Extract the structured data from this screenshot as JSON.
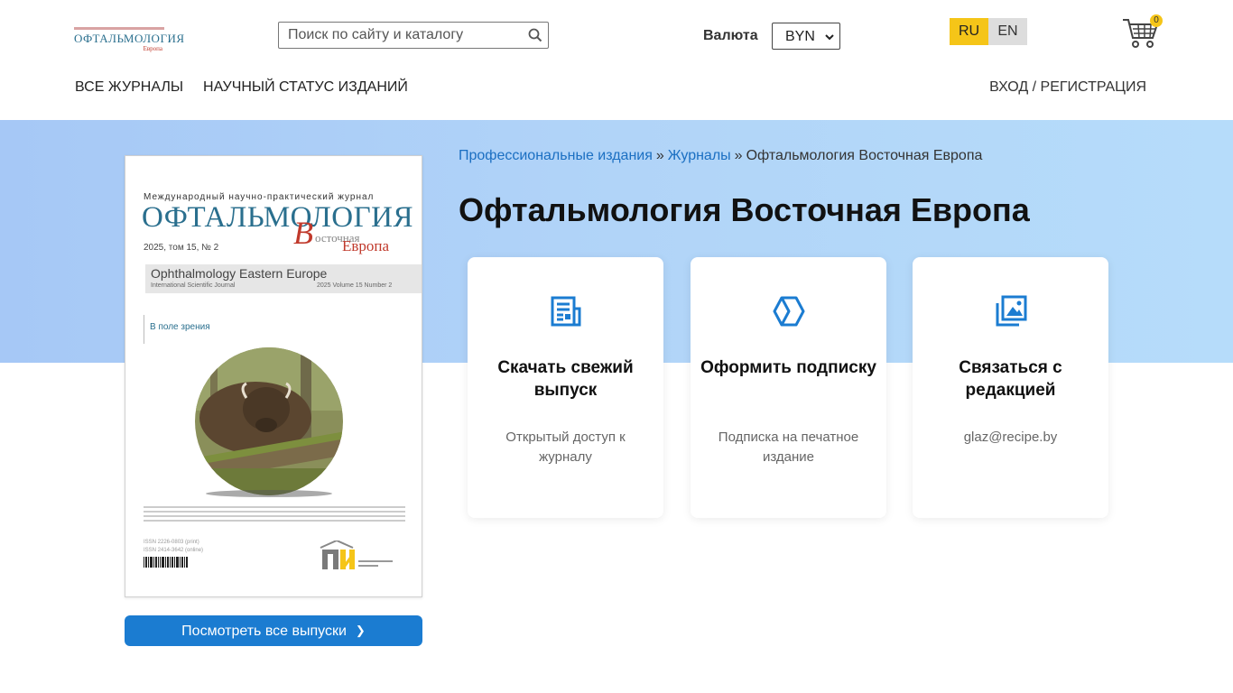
{
  "header": {
    "logo_text": "ОФТАЛЬМОЛОГИЯ",
    "logo_sub": "Европа",
    "search_placeholder": "Поиск по сайту и каталогу",
    "currency_label": "Валюта",
    "currency_value": "BYN",
    "lang_ru": "RU",
    "lang_en": "EN",
    "cart_count": "0"
  },
  "nav": {
    "all_journals": "ВСЕ ЖУРНАЛЫ",
    "scientific_status": "НАУЧНЫЙ СТАТУС ИЗДАНИЙ",
    "login": "ВХОД / РЕГИСТРАЦИЯ"
  },
  "breadcrumb": {
    "item1": "Профессиональные издания",
    "sep": "»",
    "item2": "Журналы",
    "current": "Офтальмология Восточная Европа"
  },
  "page_title": "Офтальмология Восточная Европа",
  "cover": {
    "small_top": "Международный научно-практический журнал",
    "title": "ОФТАЛЬМОЛОГИЯ",
    "letter_v": "В",
    "vostochnaya": "осточная",
    "evropa": "Европа",
    "issue": "2025, том 15, № 2",
    "en_title": "Ophthalmology Eastern Europe",
    "en_sub": "International Scientific Journal",
    "en_issue": "2025  Volume 15  Number 2",
    "field": "В поле зрения",
    "isbn1": "ISSN 2226-0803 (print)",
    "isbn2": "ISSN 2414-3642 (online)"
  },
  "view_all_button": "Посмотреть все выпуски",
  "cards": [
    {
      "title": "Скачать свежий выпуск",
      "desc": "Открытый доступ к журналу",
      "icon": "document-icon"
    },
    {
      "title": "Оформить подписку",
      "desc": "Подписка на печатное издание",
      "icon": "cube-icon"
    },
    {
      "title": "Связаться с редакцией",
      "desc": "glaz@recipe.by",
      "icon": "images-icon"
    }
  ],
  "colors": {
    "accent_blue": "#1b7cd1",
    "link_blue": "#1b6fc2",
    "lang_active": "#f5c518",
    "band_start": "#a6c8f6",
    "band_end": "#b6dcfa"
  }
}
